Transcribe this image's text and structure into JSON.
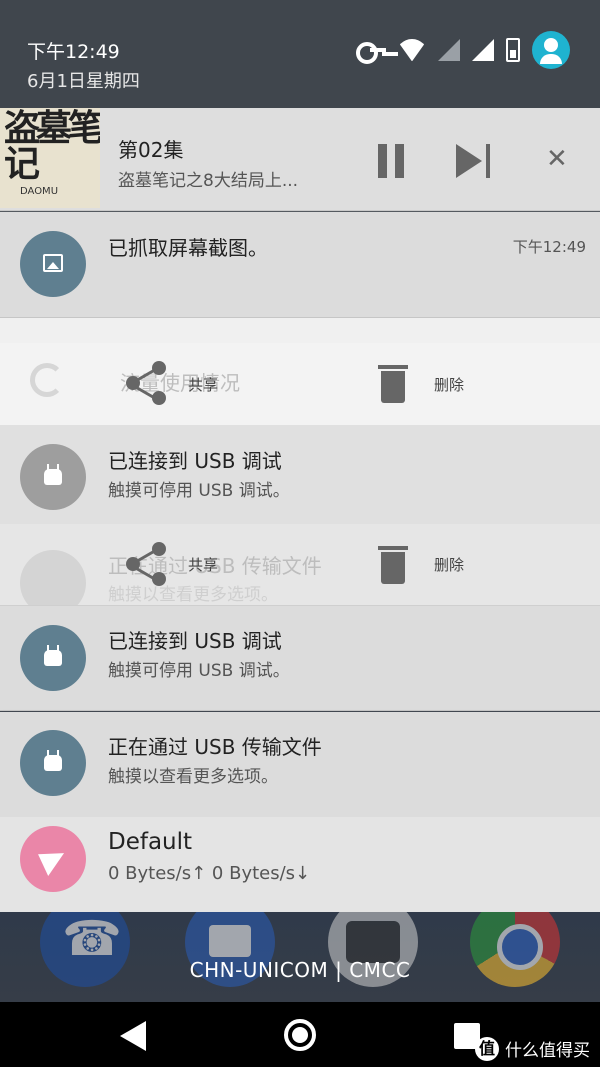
{
  "header": {
    "time": "下午12:49",
    "date": "6月1日星期四",
    "icons": [
      "vpn-key-icon",
      "wifi-icon",
      "signal-icon",
      "signal-icon",
      "battery-icon",
      "user-avatar-icon"
    ]
  },
  "media": {
    "album_text": "盗墓笔记",
    "album_sub": "DAOMU",
    "episode": "第02集",
    "subtitle": "盗墓笔记之8大结局上...",
    "icons": [
      "pause-icon",
      "skip-next-icon",
      "close-icon"
    ]
  },
  "screenshot_notif": {
    "title": "已抓取屏幕截图。",
    "time": "下午12:49",
    "icon": "image-icon"
  },
  "ghost_row_1": {
    "text": "流量使用情况",
    "share_label": "共享",
    "delete_label": "删除"
  },
  "usb_debug_1": {
    "title": "已连接到 USB 调试",
    "sub": "触摸可停用 USB 调试。"
  },
  "ghost_row_2": {
    "title": "正在通过 USB 传输文件",
    "sub": "触摸以查看更多选项。",
    "share_label": "共享",
    "delete_label": "删除"
  },
  "usb_debug_2": {
    "title": "已连接到 USB 调试",
    "sub": "触摸可停用 USB 调试。"
  },
  "usb_transfer": {
    "title": "正在通过 USB 传输文件",
    "sub": "触摸以查看更多选项。"
  },
  "speed": {
    "title": "Default",
    "sub": "0 Bytes/s↑  0 Bytes/s↓"
  },
  "carrier": "CHN-UNICOM | CMCC",
  "watermark": "什么值得买",
  "watermark_logo": "值",
  "colors": {
    "header_bg": "#40464d",
    "avatar": "#1fb3d0",
    "notif_icon": "#5f7f90",
    "speed_icon": "#ea86a8"
  }
}
